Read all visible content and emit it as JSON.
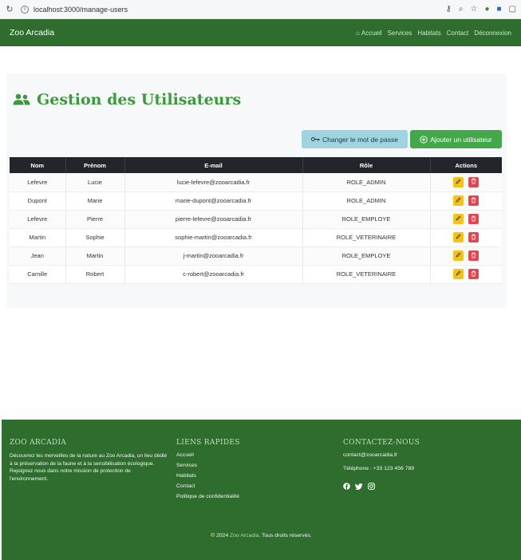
{
  "browser": {
    "url": "localhost:3000/manage-users"
  },
  "navbar": {
    "brand": "Zoo Arcadia",
    "links": [
      {
        "label": "Accueil"
      },
      {
        "label": "Services"
      },
      {
        "label": "Habitats"
      },
      {
        "label": "Contact"
      },
      {
        "label": "Déconnexion"
      }
    ]
  },
  "page": {
    "title": "Gestion des Utilisateurs",
    "change_password_label": "Changer le mot de passe",
    "add_user_label": "Ajouter un utilisateur"
  },
  "table": {
    "headers": [
      "Nom",
      "Prénom",
      "E-mail",
      "Rôle",
      "Actions"
    ],
    "rows": [
      {
        "nom": "Lefevre",
        "prenom": "Lucie",
        "email": "lucie-lefevre@zooarcadia.fr",
        "role": "ROLE_ADMIN"
      },
      {
        "nom": "Dupont",
        "prenom": "Marie",
        "email": "marie-dupont@zooarcadia.fr",
        "role": "ROLE_ADMIN"
      },
      {
        "nom": "Lefevre",
        "prenom": "Pierre",
        "email": "pierre-lefevre@zooarcadia.fr",
        "role": "ROLE_EMPLOYE"
      },
      {
        "nom": "Martin",
        "prenom": "Sophie",
        "email": "sophie-martin@zooarcadia.fr",
        "role": "ROLE_VETERINAIRE"
      },
      {
        "nom": "Jean",
        "prenom": "Martin",
        "email": "j-martin@zooarcadia.fr",
        "role": "ROLE_EMPLOYE"
      },
      {
        "nom": "Camille",
        "prenom": "Robert",
        "email": "c-robert@zooarcadia.fr",
        "role": "ROLE_VETERINAIRE"
      }
    ]
  },
  "footer": {
    "about_title": "ZOO ARCADIA",
    "about_text": "Découvrez les merveilles de la nature au Zoo Arcadia, un lieu dédié à la préservation de la faune et à la sensibilisation écologique. Rejoignez nous dans notre mission de protection de l'environnement.",
    "links_title": "LIENS RAPIDES",
    "links": [
      "Accueil",
      "Services",
      "Habitats",
      "Contact",
      "Politique de confidentialité"
    ],
    "contact_title": "CONTACTEZ-NOUS",
    "contact_email": "contact@zooarcadia.fr",
    "contact_phone": "Téléphone : +33 123 456 789",
    "copyright_prefix": "© 2024 ",
    "copyright_brand": "Zoo Arcadia",
    "copyright_suffix": ". Tous droits réservés."
  },
  "colors": {
    "primary_green": "#2f6d2f",
    "accent_green": "#43a84a",
    "info_blue": "#9fd3e0",
    "edit_yellow": "#f3c21b",
    "delete_red": "#e14651",
    "table_header": "#22262a"
  },
  "icons": [
    "users-icon",
    "key-icon",
    "plus-circle-icon",
    "home-icon",
    "pencil-icon",
    "trash-icon",
    "facebook-icon",
    "twitter-icon",
    "instagram-icon"
  ]
}
